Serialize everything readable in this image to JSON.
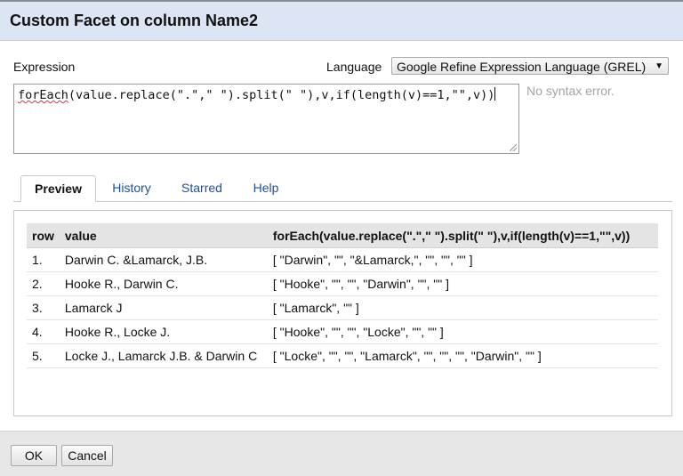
{
  "dialog": {
    "title": "Custom Facet on column Name2"
  },
  "expression": {
    "label": "Expression",
    "language_label": "Language",
    "language_value": "Google Refine Expression Language (GREL)",
    "code_part1": "forEach",
    "code_part2": "(value.replace(\".\",\" \").split(\" \"),v,if(length(v)==1,\"\",v))",
    "status": "No syntax error."
  },
  "tabs": [
    {
      "label": "Preview",
      "active": true
    },
    {
      "label": "History",
      "active": false
    },
    {
      "label": "Starred",
      "active": false
    },
    {
      "label": "Help",
      "active": false
    }
  ],
  "preview": {
    "headers": [
      "row",
      "value",
      "forEach(value.replace(\".\",\" \").split(\" \"),v,if(length(v)==1,\"\",v))"
    ],
    "rows": [
      [
        "1.",
        "Darwin C. &Lamarck, J.B.",
        "[ \"Darwin\", \"\", \"&Lamarck,\", \"\", \"\", \"\" ]"
      ],
      [
        "2.",
        "Hooke R., Darwin C.",
        "[ \"Hooke\", \"\", \"\", \"Darwin\", \"\", \"\" ]"
      ],
      [
        "3.",
        "Lamarck J",
        "[ \"Lamarck\", \"\" ]"
      ],
      [
        "4.",
        "Hooke R., Locke J.",
        "[ \"Hooke\", \"\", \"\", \"Locke\", \"\", \"\" ]"
      ],
      [
        "5.",
        "Locke J., Lamarck J.B. & Darwin C",
        "[ \"Locke\", \"\", \"\", \"Lamarck\", \"\", \"\", \"\", \"Darwin\", \"\" ]"
      ]
    ]
  },
  "buttons": {
    "ok": "OK",
    "cancel": "Cancel"
  }
}
